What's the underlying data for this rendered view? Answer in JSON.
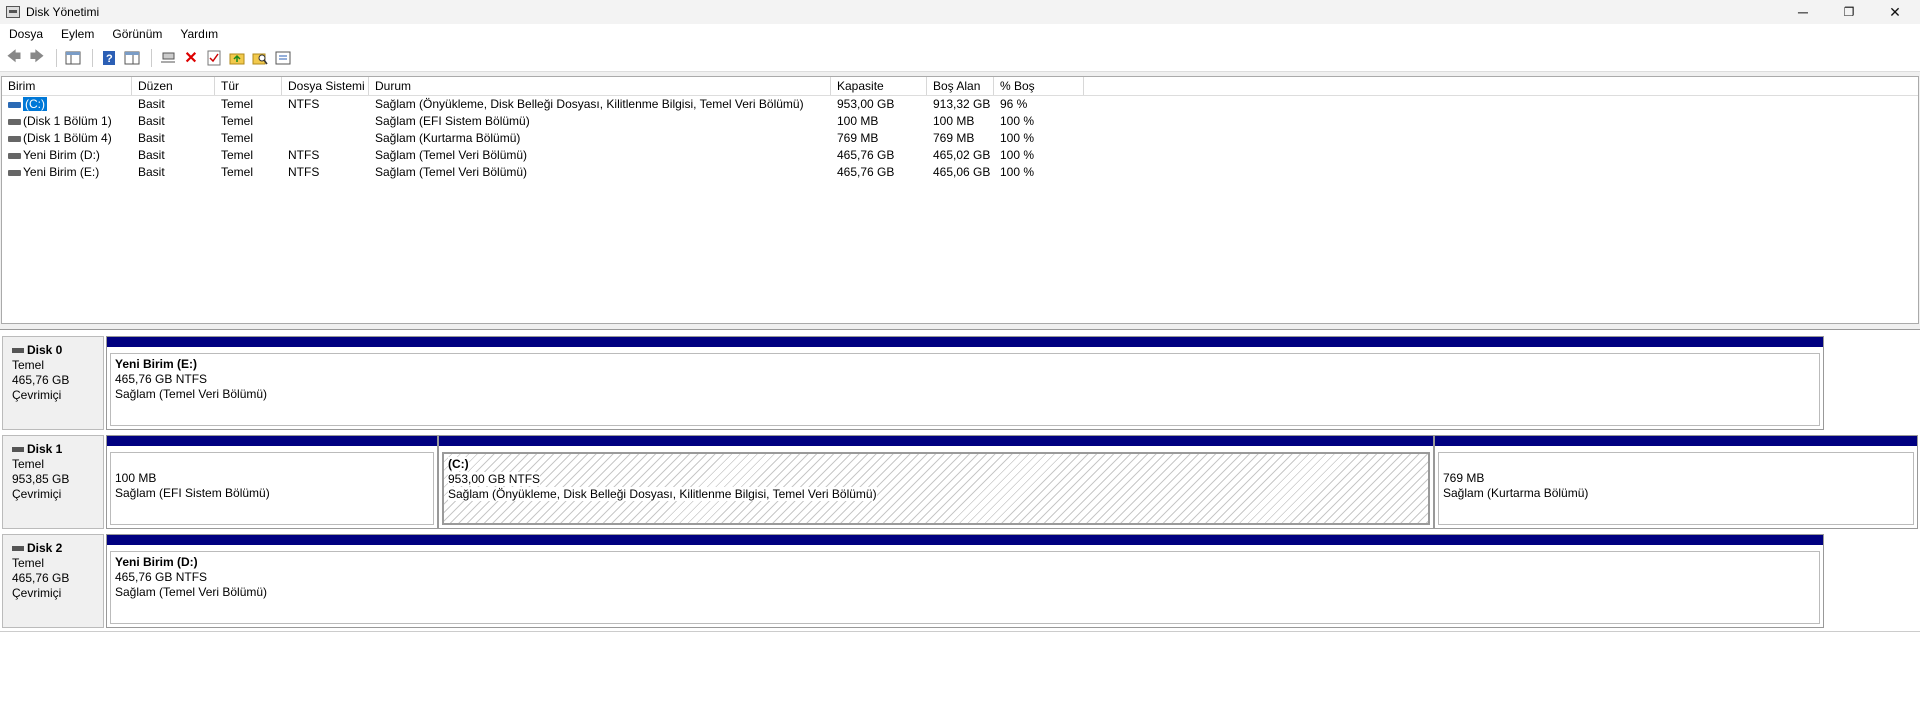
{
  "window": {
    "title": "Disk Yönetimi",
    "minimize": "─",
    "restore": "❐",
    "close": "✕"
  },
  "menu": [
    "Dosya",
    "Eylem",
    "Görünüm",
    "Yardım"
  ],
  "toolbar": {
    "icons": [
      "back-icon",
      "forward-icon",
      "console-tree-icon",
      "help-icon",
      "show-hide-icon",
      "connect-icon",
      "delete-icon",
      "properties-icon",
      "up-icon",
      "search-icon",
      "list-icon"
    ]
  },
  "volume_list": {
    "columns": [
      "Birim",
      "Düzen",
      "Tür",
      "Dosya Sistemi",
      "Durum",
      "Kapasite",
      "Boş Alan",
      "% Boş"
    ],
    "rows": [
      [
        "(C:)",
        "Basit",
        "Temel",
        "NTFS",
        "Sağlam (Önyükleme, Disk Belleği Dosyası, Kilitlenme Bilgisi, Temel Veri Bölümü)",
        "953,00 GB",
        "913,32 GB",
        "96 %"
      ],
      [
        "(Disk 1 Bölüm 1)",
        "Basit",
        "Temel",
        "",
        "Sağlam (EFI Sistem Bölümü)",
        "100 MB",
        "100 MB",
        "100 %"
      ],
      [
        "(Disk 1 Bölüm 4)",
        "Basit",
        "Temel",
        "",
        "Sağlam (Kurtarma Bölümü)",
        "769 MB",
        "769 MB",
        "100 %"
      ],
      [
        "Yeni Birim (D:)",
        "Basit",
        "Temel",
        "NTFS",
        "Sağlam (Temel Veri Bölümü)",
        "465,76 GB",
        "465,02 GB",
        "100 %"
      ],
      [
        "Yeni Birim (E:)",
        "Basit",
        "Temel",
        "NTFS",
        "Sağlam (Temel Veri Bölümü)",
        "465,76 GB",
        "465,06 GB",
        "100 %"
      ]
    ]
  },
  "disks": [
    {
      "name": "Disk 0",
      "type": "Temel",
      "size": "465,76 GB",
      "status": "Çevrimiçi",
      "partitions": [
        {
          "name": "Yeni Birim  (E:)",
          "size": "465,76 GB NTFS",
          "status": "Sağlam (Temel Veri Bölümü)"
        }
      ]
    },
    {
      "name": "Disk 1",
      "type": "Temel",
      "size": "953,85 GB",
      "status": "Çevrimiçi",
      "partitions": [
        {
          "name": "",
          "size": "100 MB",
          "status": "Sağlam (EFI Sistem Bölümü)"
        },
        {
          "name": "(C:)",
          "size": "953,00 GB NTFS",
          "status": "Sağlam (Önyükleme, Disk Belleği Dosyası, Kilitlenme Bilgisi, Temel Veri Bölümü)"
        },
        {
          "name": "",
          "size": "769 MB",
          "status": "Sağlam (Kurtarma Bölümü)"
        }
      ]
    },
    {
      "name": "Disk 2",
      "type": "Temel",
      "size": "465,76 GB",
      "status": "Çevrimiçi",
      "partitions": [
        {
          "name": "Yeni Birim  (D:)",
          "size": "465,76 GB NTFS",
          "status": "Sağlam (Temel Veri Bölümü)"
        }
      ]
    }
  ],
  "colors": {
    "partition_bar": "#000080",
    "selection": "#0078d7"
  }
}
